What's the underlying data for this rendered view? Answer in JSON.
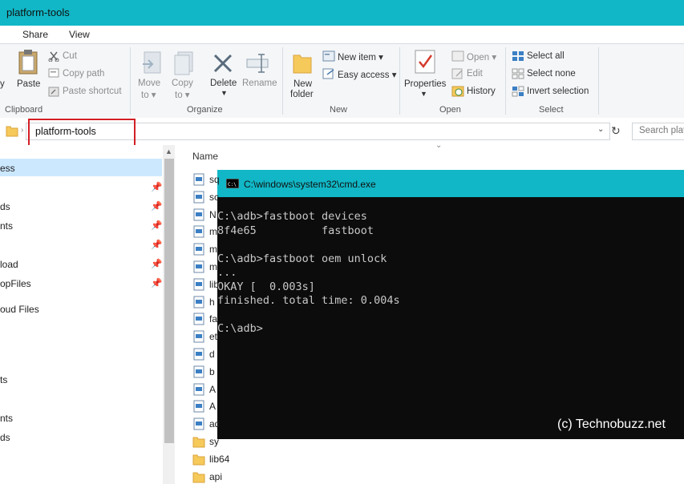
{
  "window": {
    "title": "platform-tools"
  },
  "tabs": [
    "Share",
    "View"
  ],
  "ribbon": {
    "clipboard": {
      "group": "Clipboard",
      "left_label": "y",
      "paste": "Paste",
      "cut": "Cut",
      "copy_path": "Copy path",
      "paste_shortcut": "Paste shortcut"
    },
    "organize": {
      "group": "Organize",
      "move_to": [
        "Move",
        "to ▾"
      ],
      "copy_to": [
        "Copy",
        "to ▾"
      ],
      "delete": "Delete",
      "rename": "Rename"
    },
    "new": {
      "group": "New",
      "new_folder": [
        "New",
        "folder"
      ],
      "new_item": "New item ▾",
      "easy_access": "Easy access ▾"
    },
    "open": {
      "group": "Open",
      "properties": "Properties",
      "open": "Open ▾",
      "edit": "Edit",
      "history": "History"
    },
    "select": {
      "group": "Select",
      "select_all": "Select all",
      "select_none": "Select none",
      "invert": "Invert selection"
    }
  },
  "address": {
    "path": "platform-tools",
    "search_placeholder": "Search platf"
  },
  "nav": {
    "items": [
      "ess",
      "ds",
      "nts",
      "load",
      "opFiles",
      "oud Files",
      "ts",
      "nts",
      "ds"
    ]
  },
  "filelist": {
    "header": "Name",
    "rows": [
      "sq",
      "sc",
      "N",
      "m",
      "m",
      "m",
      "lib",
      "h",
      "fa",
      "et",
      "d",
      "b",
      "A",
      "A",
      "ad",
      "sy",
      "lib64",
      "api"
    ]
  },
  "cmd": {
    "title": "C:\\windows\\system32\\cmd.exe",
    "lines": [
      "C:\\adb>fastboot devices",
      "8f4e65          fastboot",
      "",
      "C:\\adb>fastboot oem unlock",
      "...",
      "OKAY [  0.003s]",
      "finished. total time: 0.004s",
      "",
      "C:\\adb>"
    ],
    "watermark": "(c) Technobuzz.net"
  },
  "colors": {
    "titlebar": "#11b7c6",
    "highlight": "#d21f25",
    "selection": "#cce8ff"
  }
}
